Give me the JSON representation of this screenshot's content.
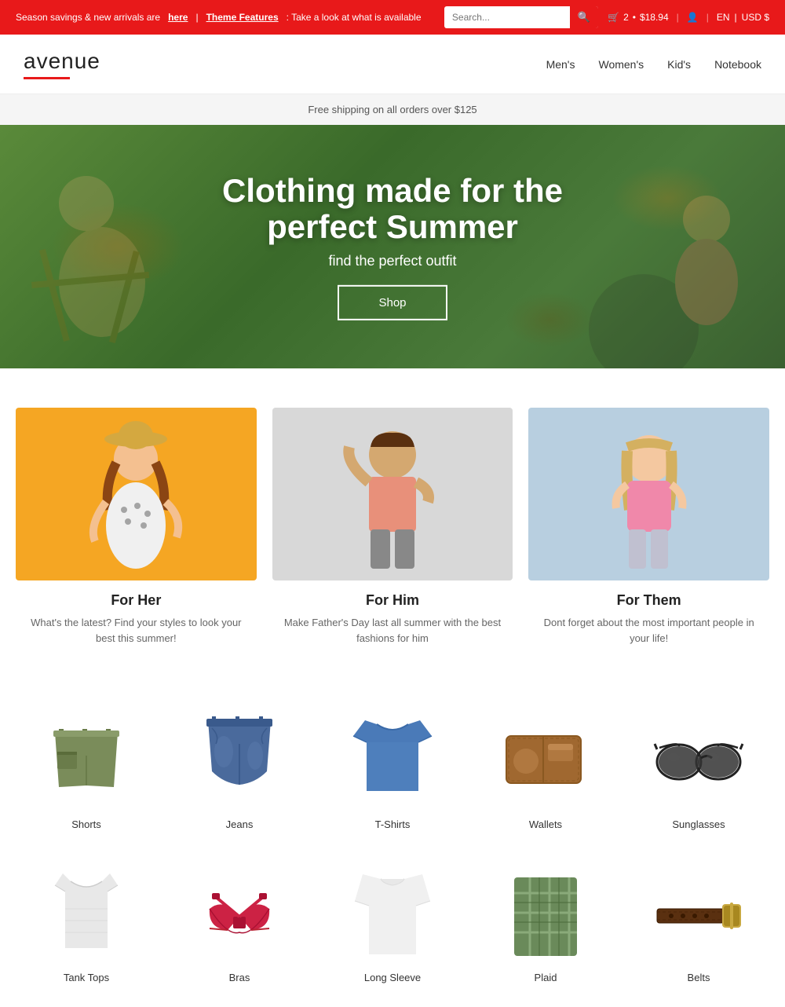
{
  "announcement": {
    "text1": "Season savings & new arrivals are",
    "link1": "here",
    "sep": "|",
    "link2": "Theme Features",
    "text2": ": Take a look at what is available"
  },
  "search": {
    "placeholder": "Search...",
    "button_label": "🔍"
  },
  "cart": {
    "count": "2",
    "price": "$18.94"
  },
  "header": {
    "lang": "EN",
    "currency": "USD $"
  },
  "logo": {
    "text": "avenue"
  },
  "nav": {
    "items": [
      {
        "label": "Men's"
      },
      {
        "label": "Women's"
      },
      {
        "label": "Kid's"
      },
      {
        "label": "Notebook"
      }
    ]
  },
  "shipping_banner": {
    "text": "Free shipping on all orders over $125"
  },
  "hero": {
    "title": "Clothing made for the perfect Summer",
    "subtitle": "find the perfect outfit",
    "button": "Shop"
  },
  "categories": [
    {
      "title": "For Her",
      "description": "What's the latest? Find your styles to look your best this summer!"
    },
    {
      "title": "For Him",
      "description": "Make Father's Day last all summer with the best fashions for him"
    },
    {
      "title": "For Them",
      "description": "Dont forget about the most important people in your life!"
    }
  ],
  "products": [
    {
      "label": "Shorts"
    },
    {
      "label": "Jeans"
    },
    {
      "label": "T-Shirts"
    },
    {
      "label": "Wallets"
    },
    {
      "label": "Sunglasses"
    }
  ],
  "bottom_products": [
    {
      "label": "Tank Tops"
    },
    {
      "label": "Bras"
    },
    {
      "label": "Long Sleeve"
    },
    {
      "label": "Plaid"
    },
    {
      "label": "Belts"
    }
  ]
}
